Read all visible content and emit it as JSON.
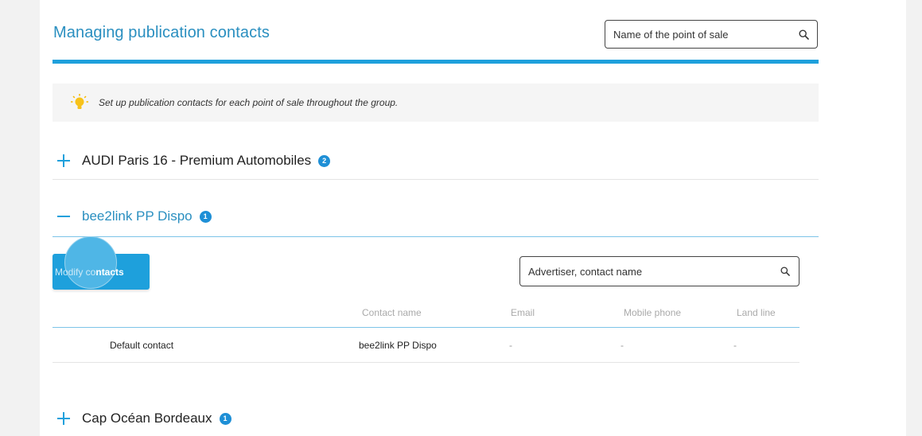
{
  "header": {
    "title": "Managing publication contacts",
    "search_placeholder": "Name of the point of sale"
  },
  "info": {
    "text": "Set up publication contacts for each point of sale throughout the group."
  },
  "groups": [
    {
      "name": "AUDI Paris 16 - Premium Automobiles",
      "count": "2",
      "expanded": false
    },
    {
      "name": "bee2link PP Dispo",
      "count": "1",
      "expanded": true
    },
    {
      "name": "Cap Océan Bordeaux",
      "count": "1",
      "expanded": false
    }
  ],
  "detail": {
    "modify_label_faded": "Modify co",
    "modify_label_bold": "ntacts",
    "search_placeholder": "Advertiser, contact name",
    "columns": [
      "Contact name",
      "Email",
      "Mobile phone",
      "Land line"
    ],
    "rows": [
      {
        "label": "Default contact",
        "contact_name": "bee2link PP Dispo",
        "email": "-",
        "mobile": "-",
        "landline": "-"
      }
    ]
  },
  "colors": {
    "accent": "#1ea0dc",
    "title": "#2a8fc0",
    "badge": "#1e8fd6"
  }
}
